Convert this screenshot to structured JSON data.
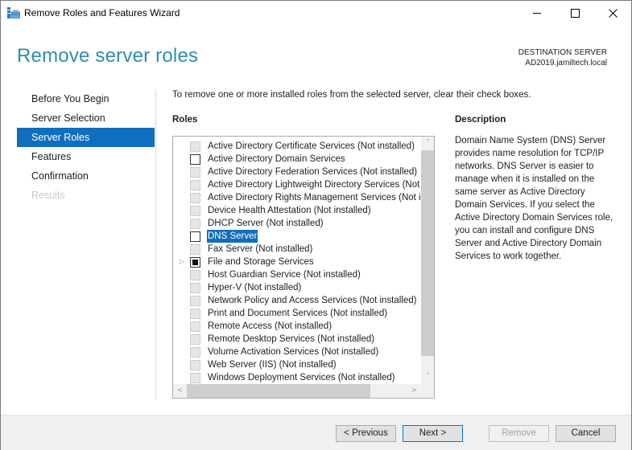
{
  "window": {
    "title": "Remove Roles and Features Wizard",
    "icon": "server-manager-icon",
    "controls": {
      "minimize": "minimize-icon",
      "maximize": "maximize-icon",
      "close": "close-icon"
    }
  },
  "header": {
    "page_title": "Remove server roles",
    "destination_label": "DESTINATION SERVER",
    "destination_server": "AD2019.jamiltech.local"
  },
  "nav": {
    "items": [
      {
        "label": "Before You Begin",
        "state": "normal"
      },
      {
        "label": "Server Selection",
        "state": "normal"
      },
      {
        "label": "Server Roles",
        "state": "active"
      },
      {
        "label": "Features",
        "state": "normal"
      },
      {
        "label": "Confirmation",
        "state": "normal"
      },
      {
        "label": "Results",
        "state": "disabled"
      }
    ]
  },
  "main": {
    "intro": "To remove one or more installed roles from the selected server, clear their check boxes.",
    "roles_heading": "Roles",
    "description_heading": "Description",
    "description": "Domain Name System (DNS) Server provides name resolution for TCP/IP networks. DNS Server is easier to manage when it is installed on the same server as Active Directory Domain Services. If you select the Active Directory Domain Services role, you can install and configure DNS Server and Active Directory Domain Services to work together.",
    "roles": [
      {
        "label": "Active Directory Certificate Services (Not installed)",
        "state": "disabled"
      },
      {
        "label": "Active Directory Domain Services",
        "state": "unchecked"
      },
      {
        "label": "Active Directory Federation Services (Not installed)",
        "state": "disabled"
      },
      {
        "label": "Active Directory Lightweight Directory Services (Not installed)",
        "state": "disabled"
      },
      {
        "label": "Active Directory Rights Management Services (Not installed)",
        "state": "disabled"
      },
      {
        "label": "Device Health Attestation (Not installed)",
        "state": "disabled"
      },
      {
        "label": "DHCP Server (Not installed)",
        "state": "disabled"
      },
      {
        "label": "DNS Server",
        "state": "unchecked",
        "selected": true
      },
      {
        "label": "Fax Server (Not installed)",
        "state": "disabled"
      },
      {
        "label": "File and Storage Services",
        "state": "partial",
        "expandable": true
      },
      {
        "label": "Host Guardian Service (Not installed)",
        "state": "disabled"
      },
      {
        "label": "Hyper-V (Not installed)",
        "state": "disabled"
      },
      {
        "label": "Network Policy and Access Services (Not installed)",
        "state": "disabled"
      },
      {
        "label": "Print and Document Services (Not installed)",
        "state": "disabled"
      },
      {
        "label": "Remote Access (Not installed)",
        "state": "disabled"
      },
      {
        "label": "Remote Desktop Services (Not installed)",
        "state": "disabled"
      },
      {
        "label": "Volume Activation Services (Not installed)",
        "state": "disabled"
      },
      {
        "label": "Web Server (IIS) (Not installed)",
        "state": "disabled"
      },
      {
        "label": "Windows Deployment Services (Not installed)",
        "state": "disabled"
      }
    ]
  },
  "footer": {
    "previous_label": "< Previous",
    "next_label": "Next >",
    "remove_label": "Remove",
    "cancel_label": "Cancel"
  }
}
